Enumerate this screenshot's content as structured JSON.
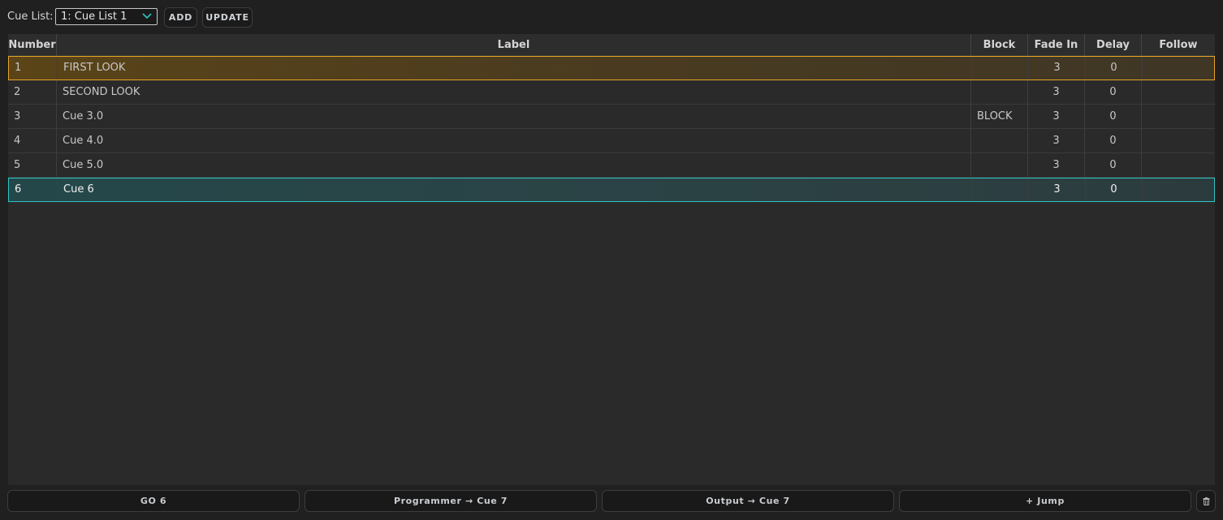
{
  "toolbar": {
    "cue_list_label": "Cue List:",
    "cue_list_selected": "1: Cue List 1",
    "add_label": "ADD",
    "update_label": "UPDATE"
  },
  "table": {
    "headers": {
      "number": "Number",
      "label": "Label",
      "block": "Block",
      "fade_in": "Fade In",
      "delay": "Delay",
      "follow": "Follow"
    },
    "rows": [
      {
        "number": "1",
        "label": "FIRST LOOK",
        "block": "",
        "fade_in": "3",
        "delay": "0",
        "follow": "",
        "state": "active"
      },
      {
        "number": "2",
        "label": "SECOND LOOK",
        "block": "",
        "fade_in": "3",
        "delay": "0",
        "follow": "",
        "state": ""
      },
      {
        "number": "3",
        "label": "Cue 3.0",
        "block": "BLOCK",
        "fade_in": "3",
        "delay": "0",
        "follow": "",
        "state": ""
      },
      {
        "number": "4",
        "label": "Cue 4.0",
        "block": "",
        "fade_in": "3",
        "delay": "0",
        "follow": "",
        "state": ""
      },
      {
        "number": "5",
        "label": "Cue 5.0",
        "block": "",
        "fade_in": "3",
        "delay": "0",
        "follow": "",
        "state": ""
      },
      {
        "number": "6",
        "label": "Cue 6",
        "block": "",
        "fade_in": "3",
        "delay": "0",
        "follow": "",
        "state": "selected"
      }
    ]
  },
  "bottom": {
    "go_label": "GO 6",
    "programmer_label": "Programmer → Cue 7",
    "output_label": "Output → Cue 7",
    "jump_label": "+ Jump",
    "trash_icon": "trash-icon"
  },
  "colors": {
    "active_border": "#e6a324",
    "selected_border": "#2ec4c4",
    "chevron": "#2ec4c4"
  }
}
